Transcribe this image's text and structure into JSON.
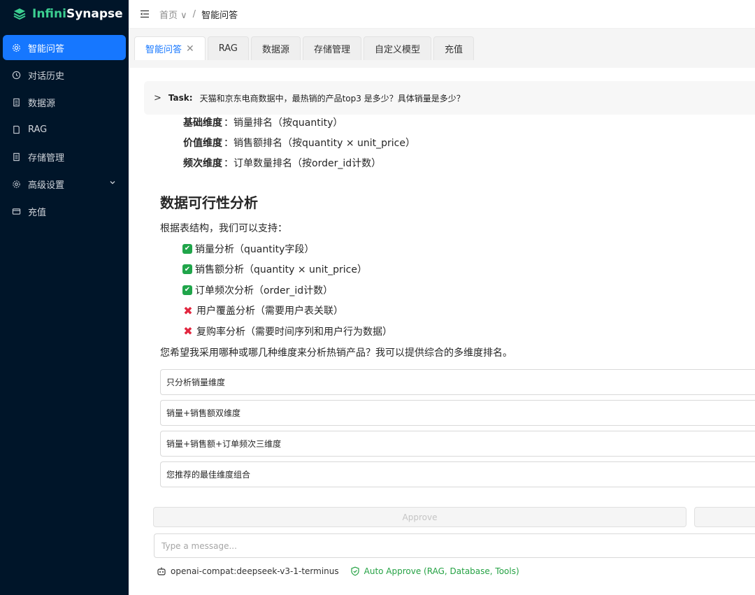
{
  "app": {
    "name_prefix": "Infini",
    "name_suffix": "Synapse",
    "accent": "#3ccf91"
  },
  "sidebar": {
    "items": [
      {
        "label": "智能问答",
        "icon": "gear-icon"
      },
      {
        "label": "对话历史",
        "icon": "history-icon"
      },
      {
        "label": "数据源",
        "icon": "database-icon"
      },
      {
        "label": "RAG",
        "icon": "book-icon"
      },
      {
        "label": "存储管理",
        "icon": "storage-icon"
      },
      {
        "label": "高级设置",
        "icon": "settings-icon"
      },
      {
        "label": "充值",
        "icon": "card-icon"
      }
    ]
  },
  "header": {
    "breadcrumb_home": "首页",
    "breadcrumb_sep": "/",
    "breadcrumb_current": "智能问答"
  },
  "tabs": [
    {
      "label": "智能问答",
      "close": "✕"
    },
    {
      "label": "RAG"
    },
    {
      "label": "数据源"
    },
    {
      "label": "存储管理"
    },
    {
      "label": "自定义模型"
    },
    {
      "label": "充值"
    }
  ],
  "task": {
    "label": "Task:",
    "text": "天猫和京东电商数据中，最热销的产品top3 是多少？具体销量是多少？"
  },
  "message": {
    "dimensions": [
      {
        "name": "基础维度",
        "text": "：销量排名（按quantity）"
      },
      {
        "name": "价值维度",
        "text": "：销售额排名（按quantity × unit_price）"
      },
      {
        "name": "频次维度",
        "text": "：订单数量排名（按order_id计数）"
      }
    ],
    "heading": "数据可行性分析",
    "intro": "根据表结构，我们可以支持：",
    "supported": [
      {
        "mark": "✔",
        "text": "销量分析（quantity字段）"
      },
      {
        "mark": "✔",
        "text": "销售额分析（quantity × unit_price）"
      },
      {
        "mark": "✔",
        "text": "订单频次分析（order_id计数）"
      }
    ],
    "unsupported": [
      {
        "mark": "✖",
        "text": "用户覆盖分析（需要用户表关联）"
      },
      {
        "mark": "✖",
        "text": "复购率分析（需要时间序列和用户行为数据）"
      }
    ],
    "question": "您希望我采用哪种或哪几种维度来分析热销产品？我可以提供综合的多维度排名。"
  },
  "options": [
    "只分析销量维度",
    "销量+销售额双维度",
    "销量+销售额+订单频次三维度",
    "您推荐的最佳维度组合"
  ],
  "actions": {
    "approve": "Approve"
  },
  "input": {
    "placeholder": "Type a message..."
  },
  "footer": {
    "model": "openai-compat:deepseek-v3-1-terminus",
    "auto_approve": "Auto Approve (RAG, Database, Tools)"
  }
}
